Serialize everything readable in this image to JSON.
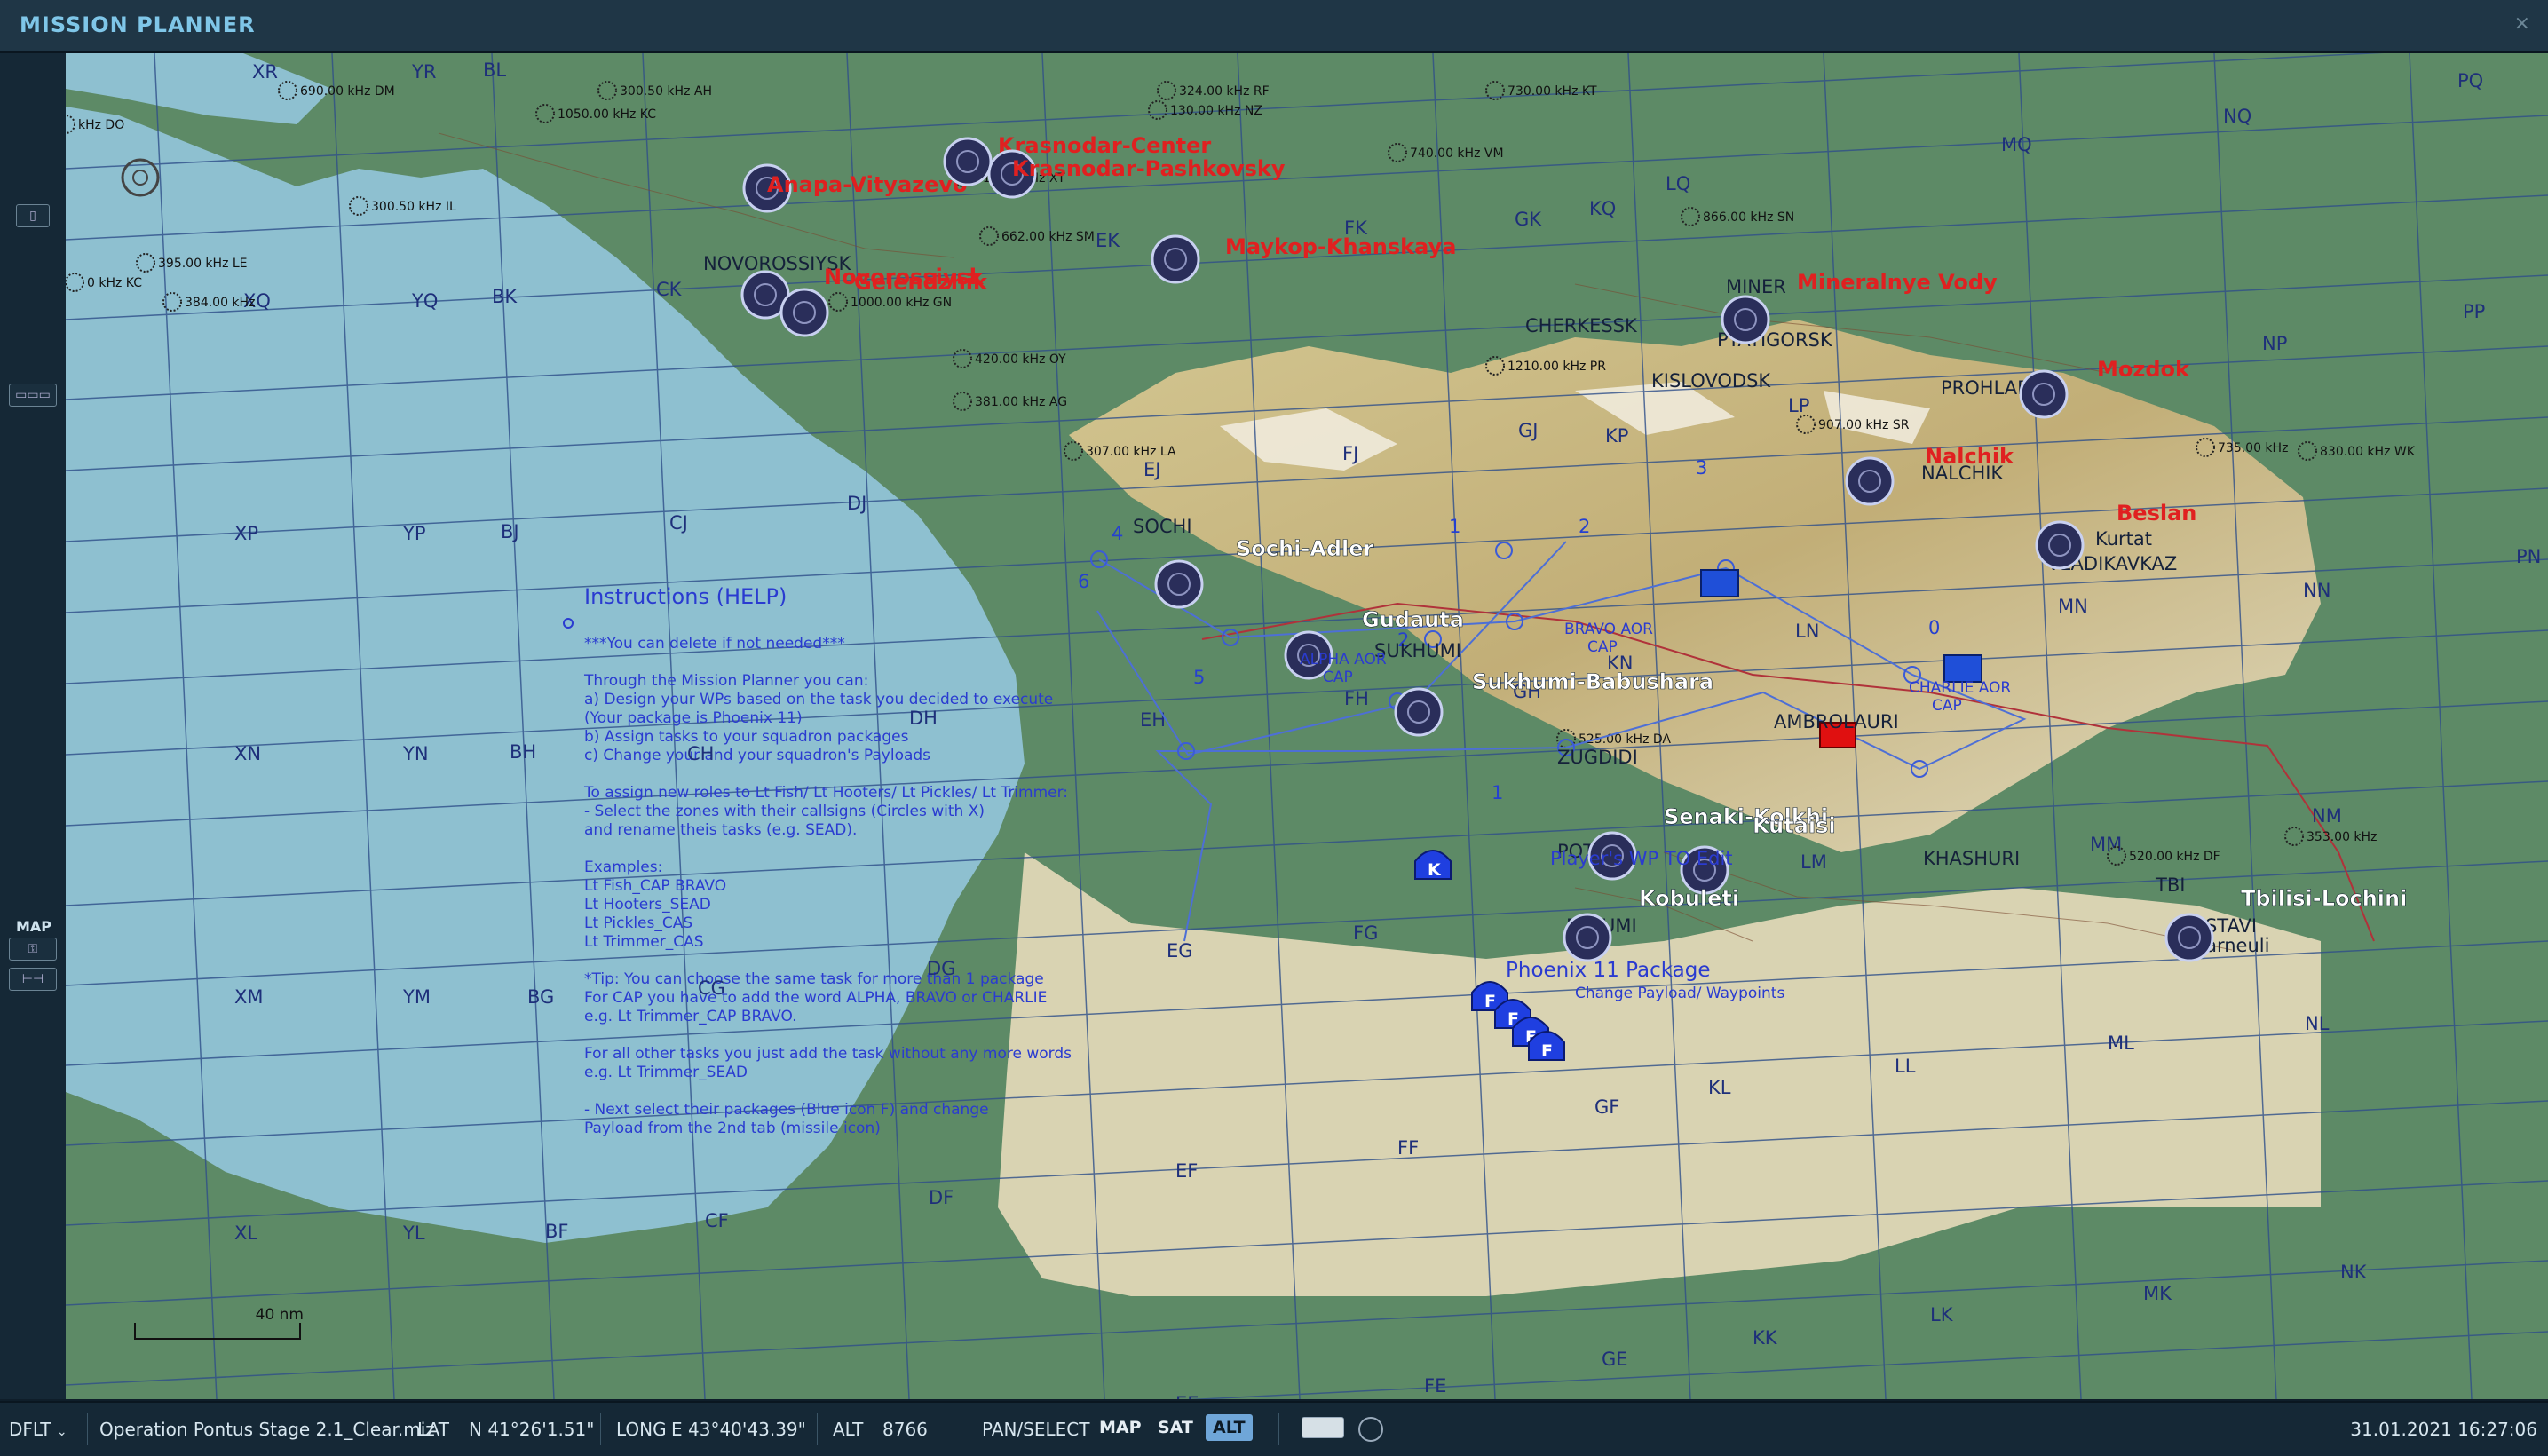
{
  "app": {
    "title": "MISSION PLANNER",
    "close_glyph": "×"
  },
  "sidebar": {
    "map_label": "MAP"
  },
  "status": {
    "profile": "DFLT",
    "mission_file": "Operation Pontus Stage 2.1_Clear.miz",
    "lat_label": "LAT",
    "lat_value": "N 41°26'1.51\"",
    "long_label": "LONG",
    "long_value": "E 43°40'43.39\"",
    "alt_label": "ALT",
    "alt_value": "8766",
    "mode": "PAN/SELECT",
    "btn_map": "MAP",
    "btn_sat": "SAT",
    "btn_alt": "ALT",
    "datetime": "31.01.2021 16:27:06"
  },
  "map": {
    "scale_label": "40 nm",
    "grid_labels": [
      "XR",
      "YR",
      "BL",
      "XQ",
      "YQ",
      "BK",
      "CK",
      "XP",
      "YP",
      "BJ",
      "CJ",
      "DJ",
      "XN",
      "YN",
      "BH",
      "CH",
      "DH",
      "EH",
      "FH",
      "XM",
      "YM",
      "BG",
      "CG",
      "DG",
      "EG",
      "FG",
      "XL",
      "YL",
      "BF",
      "CF",
      "DF",
      "EF",
      "FF",
      "GF",
      "GE",
      "FE",
      "EE",
      "KK",
      "LK",
      "MK",
      "NK",
      "KL",
      "LL",
      "ML",
      "NL",
      "NM",
      "NN",
      "PN",
      "NP",
      "PP",
      "PQ",
      "NQ",
      "MQ",
      "LQ",
      "KQ",
      "GK",
      "FK",
      "EK",
      "FJ",
      "EJ",
      "GJ",
      "KP",
      "LP",
      "MN",
      "LN",
      "KN",
      "GH",
      "LM",
      "MM"
    ],
    "airfields": [
      {
        "name": "Anapa-Vityazevo",
        "color": "#e02020"
      },
      {
        "name": "Krasnodar-Center",
        "color": "#e02020"
      },
      {
        "name": "Krasnodar-Pashkovsky",
        "color": "#e02020"
      },
      {
        "name": "Novorossiysk",
        "color": "#e02020"
      },
      {
        "name": "Gelendzhik",
        "color": "#e02020"
      },
      {
        "name": "Maykop-Khanskaya",
        "color": "#e02020"
      },
      {
        "name": "Mineralnye Vody",
        "color": "#e02020"
      },
      {
        "name": "Mozdok",
        "color": "#e02020"
      },
      {
        "name": "Nalchik",
        "color": "#e02020"
      },
      {
        "name": "Beslan",
        "color": "#e02020"
      },
      {
        "name": "Sochi-Adler",
        "color": "#ffffff"
      },
      {
        "name": "Gudauta",
        "color": "#ffffff"
      },
      {
        "name": "Sukhumi-Babushara",
        "color": "#ffffff"
      },
      {
        "name": "Senaki-Kolkhi",
        "color": "#ffffff"
      },
      {
        "name": "Kutaisi",
        "color": "#ffffff"
      },
      {
        "name": "Kobuleti",
        "color": "#ffffff"
      },
      {
        "name": "Tbilisi-Lochini",
        "color": "#ffffff"
      }
    ],
    "towns": [
      "SOCHI",
      "SUKHUMI",
      "ZUGDIDI",
      "CHERKESSK",
      "PYATIGORSK",
      "KISLOVODSK",
      "MINER",
      "PROHLADNIY",
      "NALCHIK",
      "VLADIKAVKAZ",
      "Kurtat",
      "KHASHURI",
      "TBI",
      "RUSTAVI",
      "Marneuli",
      "NOVOROSSIYSK",
      "AMBROLAURI",
      "POTI",
      "BATUMI"
    ],
    "beacons": [
      "690.00 kHz DM",
      "300.50 kHz AH",
      "1050.00 kHz KC",
      "300.50 kHz IL",
      "395.00 kHz LE",
      "384.00 kHz",
      "0 kHz KC",
      "324.00 kHz RF",
      "130.00 kHz NZ",
      "740.00 kHz VM",
      "730.00 kHz KT",
      "866.00 kHz SN",
      "662.00 kHz SM",
      "420.00 kHz OY",
      "381.00 kHz AG",
      "307.00 kHz LA",
      "1210.00 kHz PR",
      "907.00 kHz SR",
      "735.00 kHz",
      "830.00 kHz WK",
      "525.00 kHz DA",
      "353.00 kHz",
      "520.00 kHz DF",
      "1000.00 kHz GN",
      "312.00 kHz XT",
      "kHz DO"
    ],
    "aor": [
      {
        "label": "ALPHA AOR",
        "sub": "CAP"
      },
      {
        "label": "BRAVO AOR",
        "sub": "CAP"
      },
      {
        "label": "CHARLIE AOR",
        "sub": "CAP"
      }
    ],
    "package_label": "Phoenix 11 Package",
    "package_sub": "Change Payload/ Waypoints",
    "player_wp": "Player's WP TO Edit",
    "help": {
      "title": "Instructions (HELP)",
      "lines": [
        "***You can delete if not needed***",
        "",
        "Through the Mission Planner you can:",
        "a) Design your WPs based on the task you decided to execute",
        "(Your package is Phoenix 11)",
        "b) Assign tasks to your squadron packages",
        "c) Change your and your squadron's Payloads",
        "",
        "To assign new roles to Lt Fish/ Lt Hooters/ Lt Pickles/ Lt Trimmer:",
        "- Select the zones with their callsigns (Circles with X)",
        "and rename theis tasks (e.g. SEAD).",
        "",
        "Examples:",
        "Lt Fish_CAP BRAVO",
        "Lt Hooters_SEAD",
        "Lt Pickles_CAS",
        "Lt Trimmer_CAS",
        "",
        "*Tip: You can choose the same task for more than 1 package",
        "For CAP you have to add the word ALPHA, BRAVO or CHARLIE",
        "e.g. Lt Trimmer_CAP BRAVO.",
        "",
        "For all other tasks you just add the task without any more words",
        "e.g. Lt Trimmer_SEAD",
        "",
        "- Next select their packages (Blue icon F) and change",
        "Payload from the 2nd tab (missile icon)"
      ]
    },
    "waypoint_numbers": [
      "1",
      "2",
      "3",
      "4",
      "5",
      "6",
      "0",
      "1",
      "2"
    ],
    "colors": {
      "sea": "#8ec0d0",
      "land": "#5d8a66",
      "mountain": "#c9b98e",
      "snow": "#ece6d6",
      "grid": "#2f4f8a",
      "red": "#e02020",
      "blue": "#2a3bd0",
      "route": "#4d6fd6"
    }
  }
}
